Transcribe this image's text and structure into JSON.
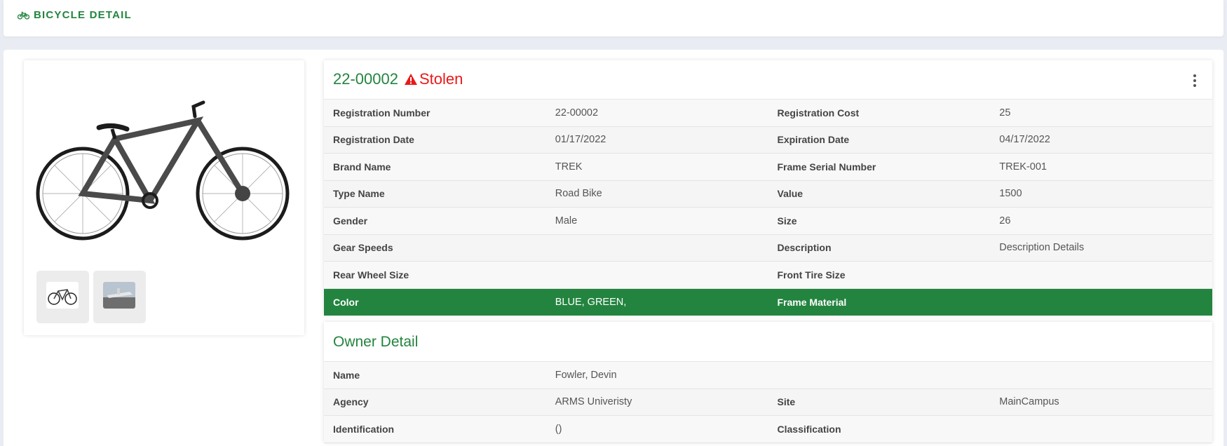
{
  "header": {
    "title": "BICYCLE DETAIL",
    "icon": "bicycle-icon"
  },
  "bicycle": {
    "reg_number": "22-00002",
    "status": "Stolen",
    "status_icon": "warning-icon",
    "rows": [
      {
        "l1": "Registration Number",
        "v1": "22-00002",
        "l2": "Registration Cost",
        "v2": "25"
      },
      {
        "l1": "Registration Date",
        "v1": "01/17/2022",
        "l2": "Expiration Date",
        "v2": "04/17/2022"
      },
      {
        "l1": "Brand Name",
        "v1": "TREK",
        "l2": "Frame Serial Number",
        "v2": "TREK-001"
      },
      {
        "l1": "Type Name",
        "v1": "Road Bike",
        "l2": "Value",
        "v2": "1500"
      },
      {
        "l1": "Gender",
        "v1": "Male",
        "l2": "Size",
        "v2": "26"
      },
      {
        "l1": "Gear Speeds",
        "v1": "",
        "l2": "Description",
        "v2": "Description Details"
      },
      {
        "l1": "Rear Wheel Size",
        "v1": "",
        "l2": "Front Tire Size",
        "v2": ""
      },
      {
        "l1": "Color",
        "v1": "BLUE, GREEN,",
        "l2": "Frame Material",
        "v2": ""
      }
    ]
  },
  "owner": {
    "title": "Owner Detail",
    "rows": [
      {
        "l1": "Name",
        "v1": "Fowler, Devin",
        "l2": "",
        "v2": ""
      },
      {
        "l1": "Agency",
        "v1": "ARMS Univeristy",
        "l2": "Site",
        "v2": "MainCampus"
      },
      {
        "l1": "Identification",
        "v1": "()",
        "l2": "Classification",
        "v2": ""
      }
    ]
  },
  "colors": {
    "accent": "#23843f",
    "danger": "#e81a1a",
    "background": "#e9edf3"
  }
}
